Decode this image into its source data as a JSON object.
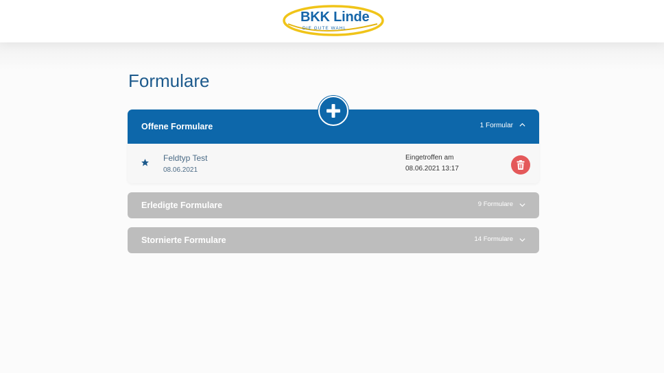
{
  "logo": {
    "title": "BKK Linde",
    "subtitle": "DIE GUTE WAHL",
    "ring_color": "#f0c419",
    "text_color": "#1565a8"
  },
  "page": {
    "title": "Formulare"
  },
  "add_button": {
    "icon": "plus-icon"
  },
  "panels": {
    "open": {
      "label": "Offene Formulare",
      "count": "1 Formular",
      "color": "#0d67aa",
      "expanded": true,
      "chevron": "chevron-up-icon",
      "items": [
        {
          "favorite_icon": "star-icon",
          "name": "Feldtyp Test",
          "date": "08.06.2021",
          "arrived_label": "Eingetroffen am",
          "arrived_value": "08.06.2021 13:17",
          "delete_icon": "trash-icon"
        }
      ]
    },
    "done": {
      "label": "Erledigte Formulare",
      "count": "9 Formulare",
      "color": "#bdbdbd",
      "expanded": false,
      "chevron": "chevron-down-icon"
    },
    "cancelled": {
      "label": "Stornierte Formulare",
      "count": "14 Formulare",
      "color": "#bdbdbd",
      "expanded": false,
      "chevron": "chevron-down-icon"
    }
  },
  "delete_color": "#e4595a"
}
